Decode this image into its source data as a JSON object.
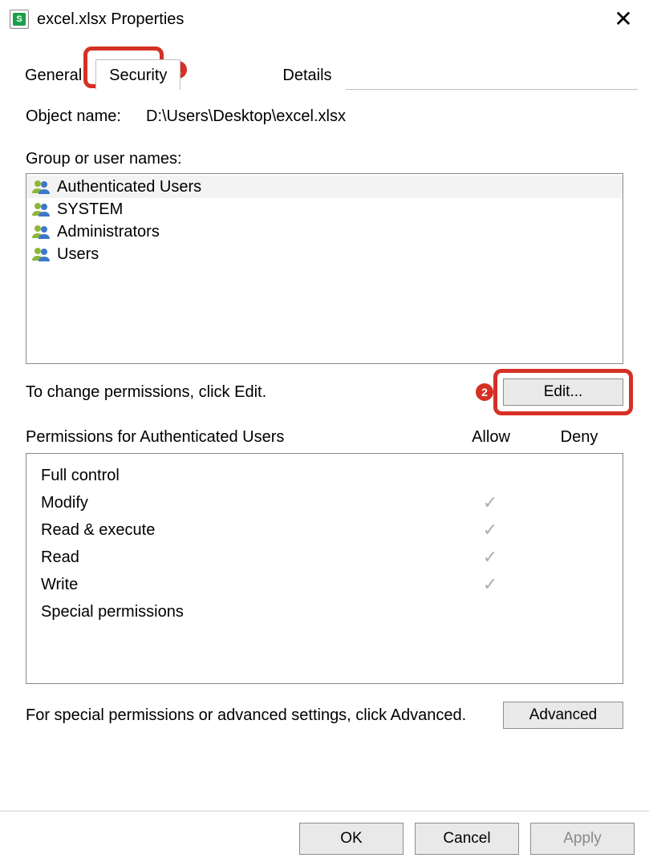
{
  "window": {
    "title": "excel.xlsx Properties",
    "icon_badge": "S"
  },
  "tabs": [
    {
      "label": "General",
      "active": false
    },
    {
      "label": "Security",
      "active": true
    },
    {
      "label": "Details",
      "active": false
    }
  ],
  "callouts": {
    "security_tab": "1",
    "edit_button": "2"
  },
  "object": {
    "label": "Object name:",
    "value": "D:\\Users\\Desktop\\excel.xlsx"
  },
  "groups": {
    "label": "Group or user names:",
    "items": [
      {
        "name": "Authenticated Users",
        "selected": true
      },
      {
        "name": "SYSTEM",
        "selected": false
      },
      {
        "name": "Administrators",
        "selected": false
      },
      {
        "name": "Users",
        "selected": false
      }
    ]
  },
  "edit": {
    "text": "To change permissions, click Edit.",
    "button": "Edit..."
  },
  "permissions": {
    "header": "Permissions for Authenticated Users",
    "allow": "Allow",
    "deny": "Deny",
    "rows": [
      {
        "name": "Full control",
        "allow": false,
        "deny": false
      },
      {
        "name": "Modify",
        "allow": true,
        "deny": false
      },
      {
        "name": "Read & execute",
        "allow": true,
        "deny": false
      },
      {
        "name": "Read",
        "allow": true,
        "deny": false
      },
      {
        "name": "Write",
        "allow": true,
        "deny": false
      },
      {
        "name": "Special permissions",
        "allow": false,
        "deny": false
      }
    ]
  },
  "advanced": {
    "text": "For special permissions or advanced settings, click Advanced.",
    "button": "Advanced"
  },
  "buttons": {
    "ok": "OK",
    "cancel": "Cancel",
    "apply": "Apply"
  }
}
